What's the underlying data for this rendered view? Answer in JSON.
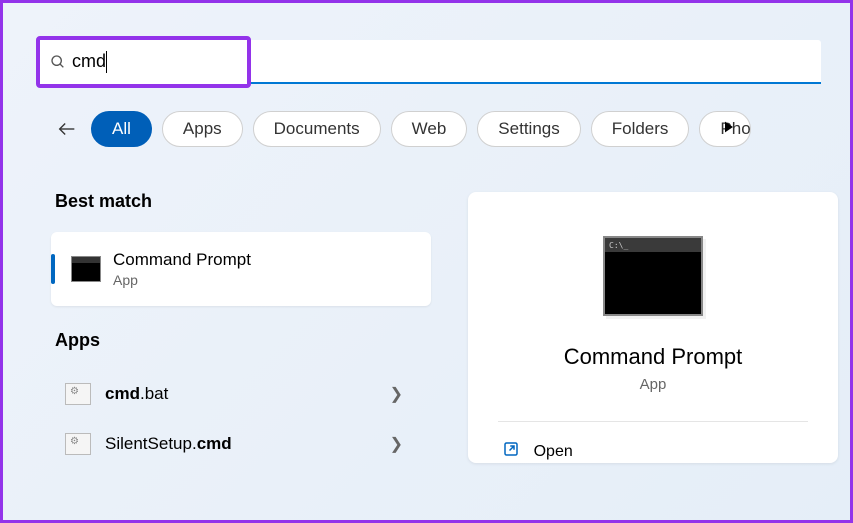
{
  "search": {
    "query": "cmd"
  },
  "filters": {
    "items": [
      {
        "label": "All",
        "active": true
      },
      {
        "label": "Apps"
      },
      {
        "label": "Documents"
      },
      {
        "label": "Web"
      },
      {
        "label": "Settings"
      },
      {
        "label": "Folders"
      },
      {
        "label": "Photos",
        "cut": true
      }
    ]
  },
  "results": {
    "best_header": "Best match",
    "best": {
      "title": "Command Prompt",
      "subtitle": "App"
    },
    "apps_header": "Apps",
    "apps": [
      {
        "prefix": "cmd",
        "suffix": ".bat"
      },
      {
        "prefix_plain": "SilentSetup.",
        "suffix_bold": "cmd"
      }
    ]
  },
  "preview": {
    "title": "Command Prompt",
    "subtitle": "App",
    "action_open": "Open"
  }
}
